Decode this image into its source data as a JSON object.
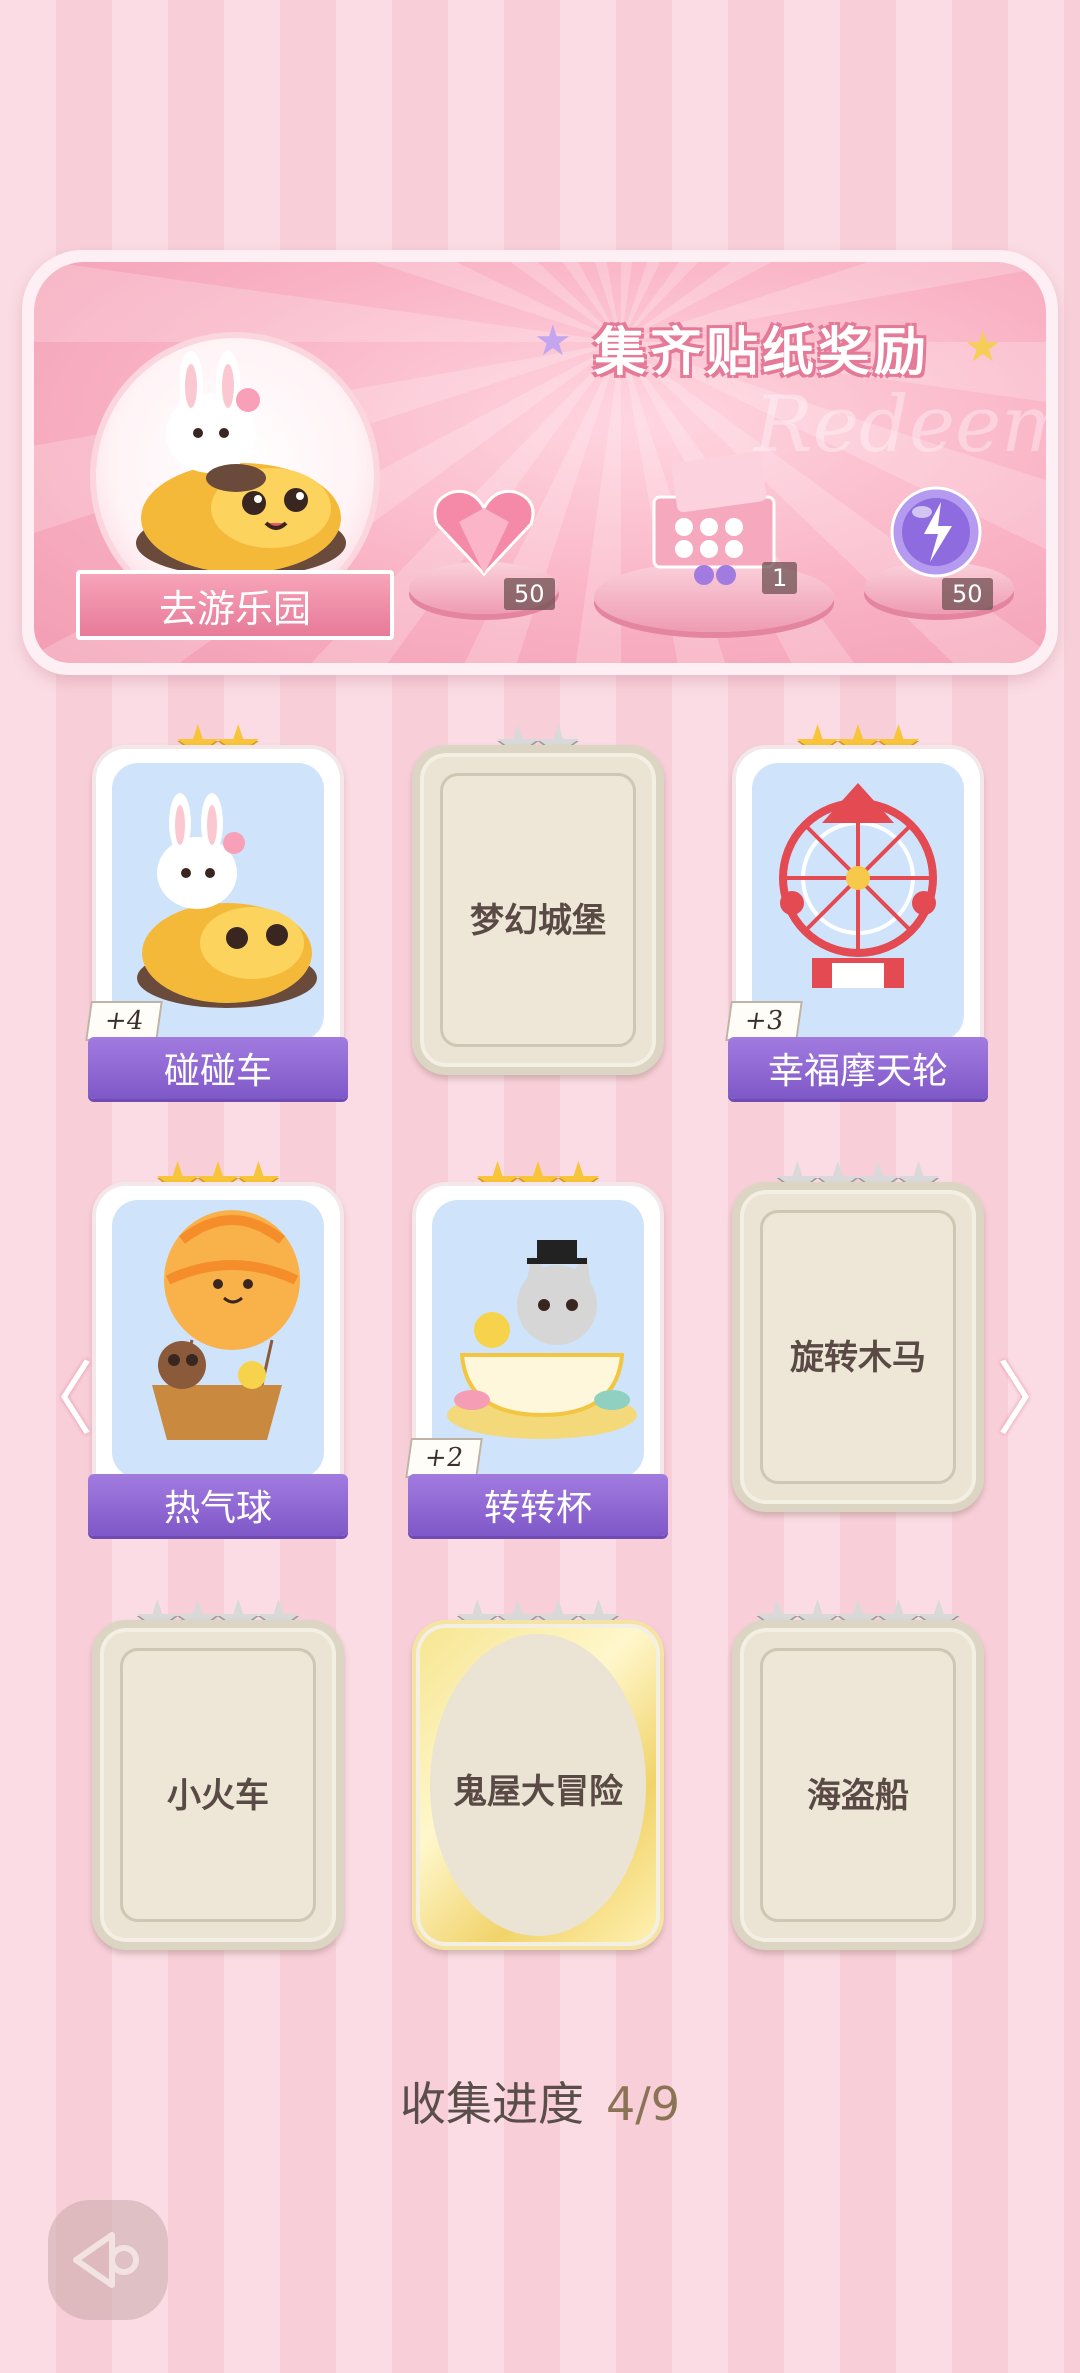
{
  "banner": {
    "title": "集齐贴纸奖励",
    "watermark": "Redeem",
    "go_park_label": "去游乐园",
    "rewards": [
      {
        "icon": "pink-heart-gem-icon",
        "count": "50"
      },
      {
        "icon": "gift-box-icon",
        "count": "1"
      },
      {
        "icon": "purple-energy-orb-icon",
        "count": "50"
      }
    ]
  },
  "cards": [
    {
      "name": "碰碰车",
      "stars_filled": 2,
      "stars_total": 2,
      "unlocked": true,
      "plus": "+4"
    },
    {
      "name": "梦幻城堡",
      "stars_filled": 0,
      "stars_total": 2,
      "unlocked": false
    },
    {
      "name": "幸福摩天轮",
      "stars_filled": 3,
      "stars_total": 3,
      "unlocked": true,
      "plus": "+3"
    },
    {
      "name": "热气球",
      "stars_filled": 3,
      "stars_total": 3,
      "unlocked": true
    },
    {
      "name": "转转杯",
      "stars_filled": 3,
      "stars_total": 3,
      "unlocked": true,
      "plus": "+2"
    },
    {
      "name": "旋转木马",
      "stars_filled": 0,
      "stars_total": 4,
      "unlocked": false
    },
    {
      "name": "小火车",
      "stars_filled": 0,
      "stars_total": 4,
      "unlocked": false
    },
    {
      "name": "鬼屋大冒险",
      "stars_filled": 0,
      "stars_total": 4,
      "unlocked": false,
      "gold": true
    },
    {
      "name": "海盗船",
      "stars_filled": 0,
      "stars_total": 5,
      "unlocked": false
    }
  ],
  "progress": {
    "label": "收集进度",
    "value": "4/9"
  },
  "nav": {
    "prev_glyph": "〈",
    "next_glyph": "〉"
  },
  "colors": {
    "accent_purple": "#8a63d2",
    "banner_pink": "#f29db3",
    "star_gold": "#f8c43a"
  }
}
